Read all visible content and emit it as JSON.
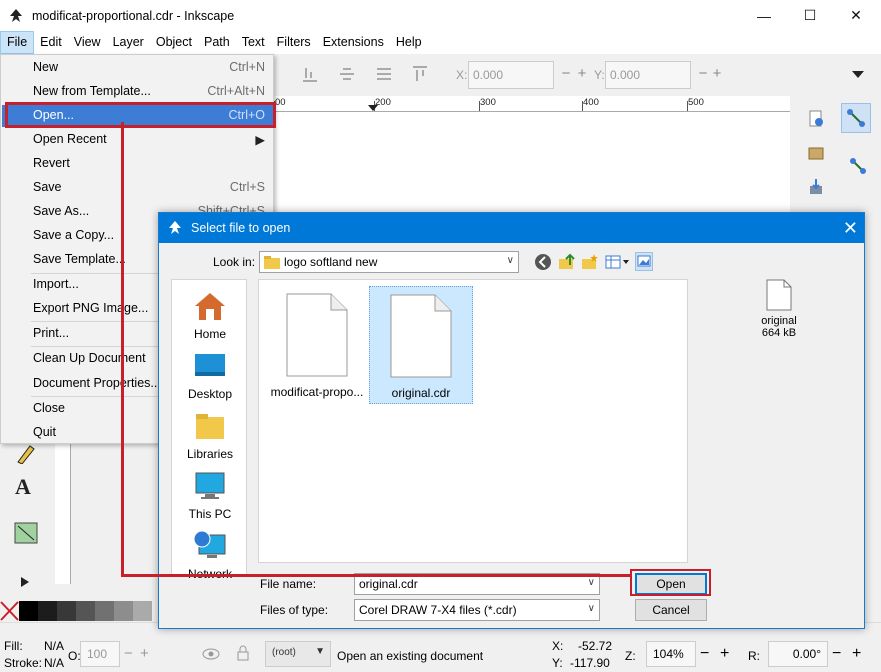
{
  "window": {
    "title": "modificat-proportional.cdr - Inkscape",
    "controls": {
      "minimize": "—",
      "maximize": "☐",
      "close": "✕"
    }
  },
  "menubar": [
    "File",
    "Edit",
    "View",
    "Layer",
    "Object",
    "Path",
    "Text",
    "Filters",
    "Extensions",
    "Help"
  ],
  "toolbar": {
    "x_label": "X:",
    "x_value": "0.000",
    "y_label": "Y:",
    "y_value": "0.000",
    "minus": "−",
    "plus": "+"
  },
  "ruler": {
    "labels": [
      "00",
      "200",
      "300",
      "400",
      "500"
    ]
  },
  "file_menu": {
    "items": [
      {
        "label": "New",
        "shortcut": "Ctrl+N"
      },
      {
        "label": "New from Template...",
        "shortcut": "Ctrl+Alt+N"
      },
      {
        "label": "Open...",
        "shortcut": "Ctrl+O"
      },
      {
        "label": "Open Recent",
        "shortcut": "▶"
      },
      {
        "label": "Revert",
        "shortcut": ""
      },
      {
        "label": "Save",
        "shortcut": "Ctrl+S"
      },
      {
        "label": "Save As...",
        "shortcut": "Shift+Ctrl+S"
      },
      {
        "label": "Save a Copy...",
        "shortcut": ""
      },
      {
        "label": "Save Template...",
        "shortcut": ""
      },
      {
        "label": "Import...",
        "shortcut": ""
      },
      {
        "label": "Export PNG Image...",
        "shortcut": ""
      },
      {
        "label": "Print...",
        "shortcut": ""
      },
      {
        "label": "Clean Up Document",
        "shortcut": ""
      },
      {
        "label": "Document Properties...",
        "shortcut": ""
      },
      {
        "label": "Close",
        "shortcut": ""
      },
      {
        "label": "Quit",
        "shortcut": ""
      }
    ]
  },
  "dialog": {
    "title": "Select file to open",
    "close": "✕",
    "look_in_label": "Look in:",
    "look_in_value": "logo softland new",
    "places": [
      "Home",
      "Desktop",
      "Libraries",
      "This PC",
      "Network"
    ],
    "files": [
      {
        "name": "modificat-propo...",
        "selected": false
      },
      {
        "name": "original.cdr",
        "selected": true
      }
    ],
    "preview": {
      "name": "original",
      "size": "664 kB"
    },
    "file_name_label": "File name:",
    "file_name_value": "original.cdr",
    "file_type_label": "Files of type:",
    "file_type_value": "Corel DRAW 7-X4 files (*.cdr)",
    "open_button": "Open",
    "cancel_button": "Cancel"
  },
  "statusbar": {
    "fill_label": "Fill:",
    "fill_value": "N/A",
    "stroke_label": "Stroke:",
    "stroke_value": "N/A",
    "opacity_label": "O:",
    "opacity_value": "100",
    "layer_value": "(root)",
    "message": "Open an existing document",
    "x_label": "X:",
    "x_value": "-52.72",
    "y_label": "Y:",
    "y_value": "-117.90",
    "zoom_label": "Z:",
    "zoom_value": "104%",
    "rotate_label": "R:",
    "rotate_value": "0.00°",
    "minus": "−",
    "plus": "+"
  },
  "colors": {
    "highlight": "#3d7dd6",
    "annotation_red": "#c8202a",
    "dialog_title": "#0078d7"
  }
}
